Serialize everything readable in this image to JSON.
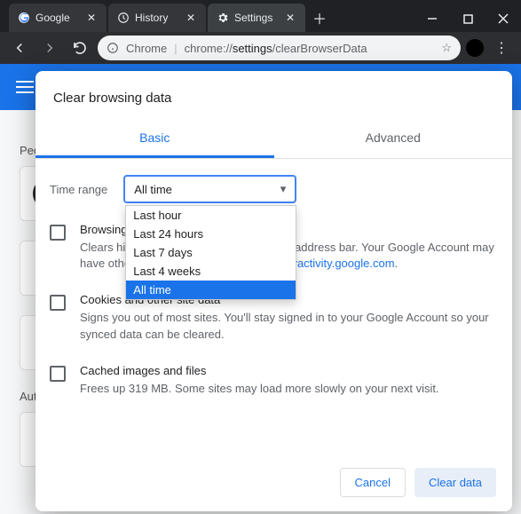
{
  "titlebar": {
    "tabs": [
      {
        "label": "Google",
        "icon": "google"
      },
      {
        "label": "History",
        "icon": "history"
      },
      {
        "label": "Settings",
        "icon": "gear",
        "active": true
      }
    ]
  },
  "omnibox": {
    "prefix": "Chrome",
    "url_scheme": "chrome://",
    "url_host": "settings",
    "url_path": "/clearBrowserData"
  },
  "background": {
    "section1": "People",
    "section2": "Autofill"
  },
  "modal": {
    "title": "Clear browsing data",
    "tabs": {
      "basic": "Basic",
      "advanced": "Advanced"
    },
    "time_label": "Time range",
    "time_selected": "All time",
    "time_options": [
      "Last hour",
      "Last 24 hours",
      "Last 7 days",
      "Last 4 weeks",
      "All time"
    ],
    "items": [
      {
        "title": "Browsing history",
        "desc_pre": "Clears history and autocompletions in the address bar. Your Google Account may have other forms of browsing history at ",
        "desc_link": "myactivity.google.com",
        "desc_post": "."
      },
      {
        "title": "Cookies and other site data",
        "desc": "Signs you out of most sites. You'll stay signed in to your Google Account so your synced data can be cleared."
      },
      {
        "title": "Cached images and files",
        "desc": "Frees up 319 MB. Some sites may load more slowly on your next visit."
      }
    ],
    "buttons": {
      "cancel": "Cancel",
      "clear": "Clear data"
    }
  }
}
